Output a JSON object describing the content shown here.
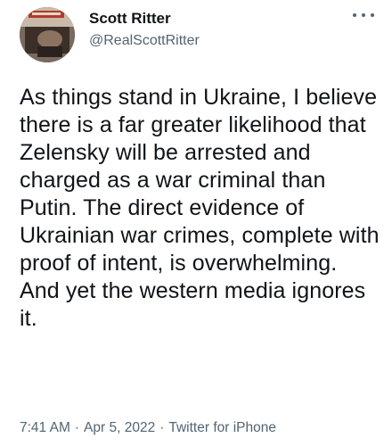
{
  "author": {
    "display_name": "Scott Ritter",
    "handle": "@RealScottRitter",
    "avatar": "avatar-photo"
  },
  "tweet": {
    "text": "As things stand in Ukraine, I believe there is a far greater likelihood that Zelensky will be arrested and charged as a war criminal than Putin. The direct evidence of Ukrainian war crimes, complete with proof of intent, is overwhelming. And yet the western media ignores it.",
    "time": "7:41 AM",
    "separator": "·",
    "date": "Apr 5, 2022",
    "source": "Twitter for iPhone"
  },
  "icons": {
    "more": "more-horizontal-icon"
  },
  "colors": {
    "text_primary": "#0f1419",
    "text_secondary": "#536471",
    "background": "#ffffff"
  }
}
